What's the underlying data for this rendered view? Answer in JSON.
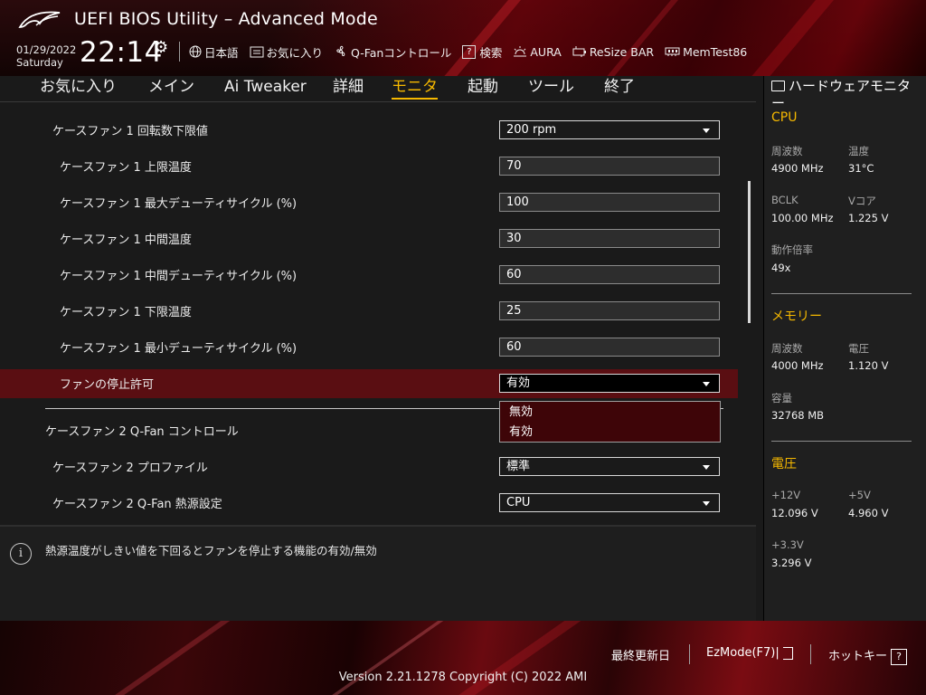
{
  "header": {
    "title": "UEFI BIOS Utility – Advanced Mode",
    "date": "01/29/2022",
    "weekday": "Saturday",
    "time": "22:14",
    "toolbar": [
      {
        "icon": "globe-icon",
        "label": "日本語"
      },
      {
        "icon": "favorites-icon",
        "label": "お気に入り"
      },
      {
        "icon": "fan-icon",
        "label": "Q-Fanコントロール"
      },
      {
        "icon": "help-search-icon",
        "label": "検索"
      },
      {
        "icon": "aura-icon",
        "label": "AURA"
      },
      {
        "icon": "resize-bar-icon",
        "label": "ReSize BAR"
      },
      {
        "icon": "memtest-icon",
        "label": "MemTest86"
      }
    ]
  },
  "tabs": [
    "お気に入り",
    "メイン",
    "Ai Tweaker",
    "詳細",
    "モニタ",
    "起動",
    "ツール",
    "終了"
  ],
  "active_tab": "モニタ",
  "settings": [
    {
      "label": "ケースファン 1 回転数下限値",
      "value": "200 rpm",
      "type": "select"
    },
    {
      "label": "ケースファン 1 上限温度",
      "value": "70",
      "type": "input"
    },
    {
      "label": "ケースファン 1 最大デューティサイクル (%)",
      "value": "100",
      "type": "input"
    },
    {
      "label": "ケースファン 1 中間温度",
      "value": "30",
      "type": "input"
    },
    {
      "label": "ケースファン 1 中間デューティサイクル (%)",
      "value": "60",
      "type": "input"
    },
    {
      "label": "ケースファン 1 下限温度",
      "value": "25",
      "type": "input"
    },
    {
      "label": "ケースファン 1 最小デューティサイクル (%)",
      "value": "60",
      "type": "input"
    },
    {
      "label": "ファンの停止許可",
      "value": "有効",
      "type": "select"
    },
    {
      "label": "ケースファン 2 Q-Fan コントロール",
      "value": "",
      "type": "header"
    },
    {
      "label": "ケースファン 2 プロファイル",
      "value": "標準",
      "type": "select"
    },
    {
      "label": "ケースファン 2 Q-Fan 熱源設定",
      "value": "CPU",
      "type": "select"
    }
  ],
  "dropdown_options": [
    "無効",
    "有効"
  ],
  "help_text": "熱源温度がしきい値を下回るとファンを停止する機能の有効/無効",
  "monitor": {
    "title": "ハードウェアモニター",
    "cpu": {
      "section": "CPU",
      "freq_label": "周波数",
      "freq": "4900 MHz",
      "temp_label": "温度",
      "temp": "31°C",
      "bclk_label": "BCLK",
      "bclk": "100.00 MHz",
      "vcore_label": "Vコア",
      "vcore": "1.225 V",
      "ratio_label": "動作倍率",
      "ratio": "49x"
    },
    "memory": {
      "section": "メモリー",
      "freq_label": "周波数",
      "freq": "4000 MHz",
      "volt_label": "電圧",
      "volt": "1.120 V",
      "cap_label": "容量",
      "cap": "32768 MB"
    },
    "voltage": {
      "section": "電圧",
      "v12_label": "+12V",
      "v12": "12.096 V",
      "v5_label": "+5V",
      "v5": "4.960 V",
      "v33_label": "+3.3V",
      "v33": "3.296 V"
    }
  },
  "footer": {
    "last_modified": "最終更新日",
    "ezmode": "EzMode(F7)|",
    "hotkey": "ホットキー",
    "hotkey_icon": "?",
    "version": "Version 2.21.1278 Copyright (C) 2022 AMI"
  },
  "colors": {
    "accent": "#f5b800",
    "highlight_row": "#5a0e12",
    "dropdown_bg": "#3e0508"
  }
}
